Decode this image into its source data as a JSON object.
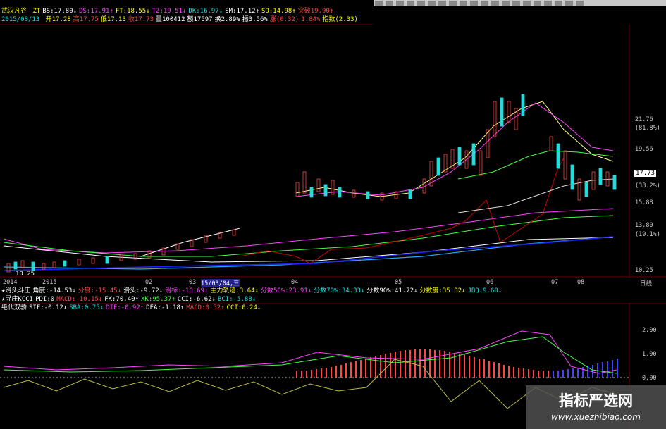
{
  "info_bar_1": {
    "name": "武汉凡谷",
    "items": [
      {
        "label": "ZT",
        "value": "",
        "color": "#ffff00"
      },
      {
        "label": "BS:",
        "value": "17.80",
        "arrow": "↓",
        "color": "#ffffff"
      },
      {
        "label": "DS:",
        "value": "17.91",
        "arrow": "↑",
        "color": "#ff44ff"
      },
      {
        "label": "FT:",
        "value": "18.55",
        "arrow": "↓",
        "color": "#ffff00"
      },
      {
        "label": "TZ:",
        "value": "19.51",
        "arrow": "↓",
        "color": "#ff44ff"
      },
      {
        "label": "DK:",
        "value": "16.97",
        "arrow": "↓",
        "color": "#22dddd"
      },
      {
        "label": "SM:",
        "value": "17.12",
        "arrow": "↑",
        "color": "#ffffff"
      },
      {
        "label": "SO:",
        "value": "14.98",
        "arrow": "↑",
        "color": "#ffff00"
      },
      {
        "label": "突破",
        "value": "19.90",
        "arrow": "↑",
        "color": "#ff4444"
      }
    ]
  },
  "info_bar_2": {
    "date": "2015/08/13",
    "items": [
      {
        "label": "开",
        "value": "17.28",
        "color": "#ffff00"
      },
      {
        "label": "高",
        "value": "17.75",
        "color": "#ff4444"
      },
      {
        "label": "低",
        "value": "17.13",
        "color": "#ffff00"
      },
      {
        "label": "收",
        "value": "17.73",
        "color": "#ff4444"
      },
      {
        "label": "量",
        "value": "100412",
        "color": "#ffffff"
      },
      {
        "label": "额",
        "value": "17597",
        "color": "#ffffff"
      },
      {
        "label": "换",
        "value": "2.89%",
        "color": "#ffffff"
      },
      {
        "label": "振",
        "value": "3.56%",
        "color": "#ffffff"
      },
      {
        "label": "涨",
        "value": "(0.32)",
        "color": "#ff4444"
      },
      {
        "label": "",
        "value": "1.84%",
        "color": "#ff4444"
      },
      {
        "label": "指数",
        "value": "(2.33)",
        "color": "#ffff00"
      }
    ]
  },
  "price_axis": {
    "labels": [
      "21.76",
      "(81.8%)",
      "19.56",
      "17.73",
      "(38.2%)",
      "15.88",
      "13.80",
      "(19.1%)",
      "10.25"
    ],
    "current": "17.73"
  },
  "low_label": "10.25",
  "time_axis": {
    "labels": [
      "2014",
      "2015",
      "02",
      "03",
      "15/03/04,三",
      "04",
      "05",
      "06",
      "07",
      "08",
      "日线"
    ]
  },
  "indicator_rows": [
    {
      "name": "★滑头斗庄",
      "items": [
        {
          "text": "角度:-14.53↓",
          "color": "#ffffff"
        },
        {
          "text": "分度:-15.45↓",
          "color": "#ff4444"
        },
        {
          "text": "滑头:-9.72↓",
          "color": "#ffffff"
        },
        {
          "text": "滑标:-10.69↑",
          "color": "#ff44ff"
        },
        {
          "text": "主力轨迹:3.64↓",
          "color": "#ffff00"
        },
        {
          "text": "分数50%:23.91↓",
          "color": "#ff44ff"
        },
        {
          "text": "分数70%:34.33↓",
          "color": "#22dddd"
        },
        {
          "text": "分数90%:41.72↓",
          "color": "#ffffff"
        },
        {
          "text": "分数度:35.02↓",
          "color": "#ffff00"
        },
        {
          "text": "JBQ:9.60↓",
          "color": "#22dddd"
        }
      ]
    },
    {
      "name": "★寻庄KCCI",
      "items": [
        {
          "text": "PDI:0",
          "color": "#ffffff"
        },
        {
          "text": "MACD:-10.15↓",
          "color": "#ff4444"
        },
        {
          "text": "FK:70.40↑",
          "color": "#ffffff"
        },
        {
          "text": "XK:95.37↑",
          "color": "#44ff44"
        },
        {
          "text": "CCI:-6.62↓",
          "color": "#ffffff"
        },
        {
          "text": "BCI:-5.88↓",
          "color": "#22dddd"
        }
      ]
    },
    {
      "name": "绝代双骄",
      "items": [
        {
          "text": "SIF:-0.12↓",
          "color": "#ffffff"
        },
        {
          "text": "SBA:0.75↓",
          "color": "#22dddd"
        },
        {
          "text": "DIF:-0.92↑",
          "color": "#ff44ff"
        },
        {
          "text": "DEA:-1.18↑",
          "color": "#ffffff"
        },
        {
          "text": "MACD:0.52↑",
          "color": "#ff4444"
        },
        {
          "text": "CCI:0.24↓",
          "color": "#ffff00"
        }
      ]
    }
  ],
  "sub_axis": {
    "labels": [
      "2.00",
      "1.00",
      "0.00"
    ]
  },
  "toolbar": {
    "button_count": 20
  },
  "watermark": {
    "title": "指标严选网",
    "url": "www.xuezhibiao.com"
  }
}
